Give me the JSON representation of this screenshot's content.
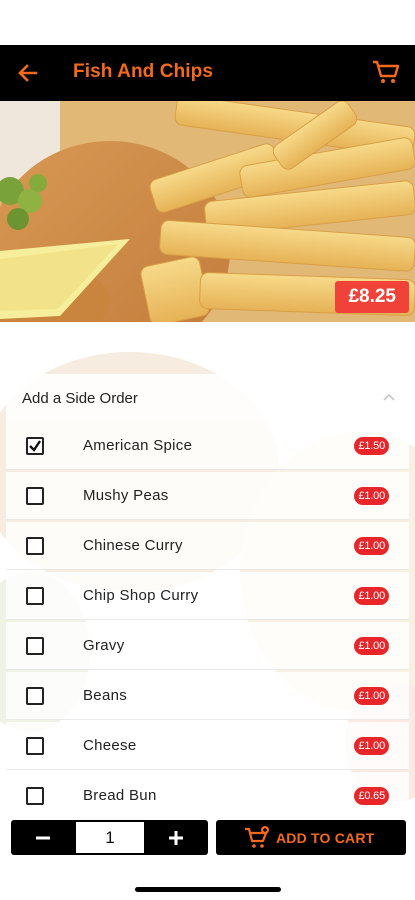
{
  "header": {
    "title": "Fish And Chips",
    "back_icon": "back-arrow-icon",
    "cart_icon": "cart-icon"
  },
  "hero": {
    "price": "£8.25"
  },
  "side_order": {
    "title": "Add a Side Order",
    "items": [
      {
        "label": "American Spice",
        "price": "£1.50",
        "checked": true
      },
      {
        "label": "Mushy Peas",
        "price": "£1.00",
        "checked": false
      },
      {
        "label": "Chinese Curry",
        "price": "£1.00",
        "checked": false
      },
      {
        "label": "Chip Shop Curry",
        "price": "£1.00",
        "checked": false
      },
      {
        "label": "Gravy",
        "price": "£1.00",
        "checked": false
      },
      {
        "label": "Beans",
        "price": "£1.00",
        "checked": false
      },
      {
        "label": "Cheese",
        "price": "£1.00",
        "checked": false
      },
      {
        "label": "Bread Bun",
        "price": "£0.65",
        "checked": false
      }
    ]
  },
  "footer": {
    "quantity": "1",
    "add_to_cart_label": "ADD TO CART"
  },
  "colors": {
    "accent": "#f46a1a",
    "price_badge": "#e8262a",
    "header_bg": "#000000"
  }
}
